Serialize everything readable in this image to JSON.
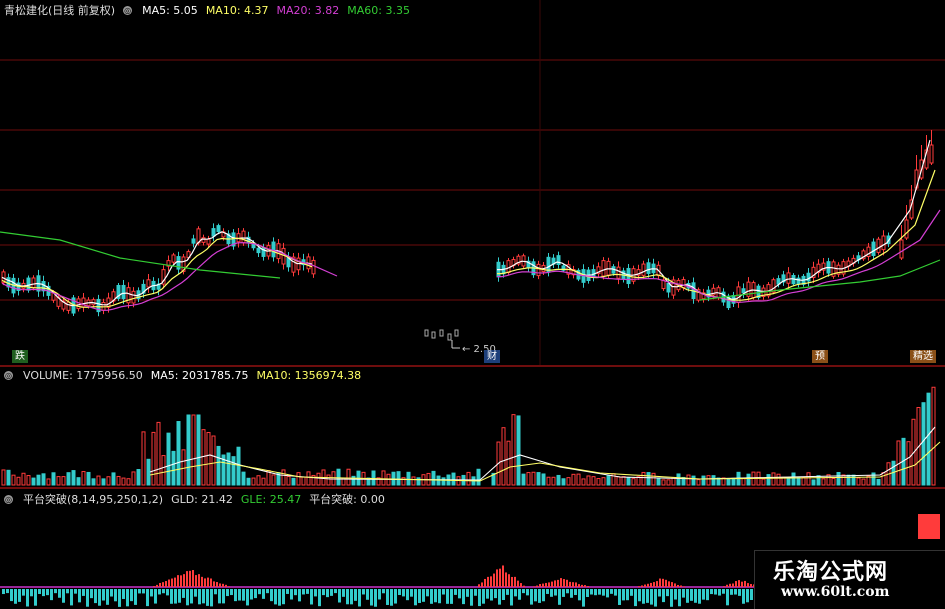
{
  "price": {
    "stock_label": "青松建化(日线 前复权)",
    "ma5": {
      "label": "MA5: 5.05",
      "color": "#ffffff"
    },
    "ma10": {
      "label": "MA10: 4.37",
      "color": "#ffff66"
    },
    "ma20": {
      "label": "MA20: 3.82",
      "color": "#d43fd4"
    },
    "ma60": {
      "label": "MA60: 3.35",
      "color": "#33cc33"
    },
    "low_annotation": "2.50",
    "markers": {
      "die": "跌",
      "cai": "财",
      "yu": "预",
      "jingxuan": "精选"
    }
  },
  "volume": {
    "label": "VOLUME: 1775956.50",
    "ma5": {
      "label": "MA5: 2031785.75",
      "color": "#ffffff"
    },
    "ma10": {
      "label": "MA10: 1356974.38",
      "color": "#ffff66"
    }
  },
  "indicator": {
    "label": "平台突破(8,14,95,250,1,2)",
    "gld": {
      "label": "GLD: 21.42",
      "color": "#dddddd"
    },
    "gle": {
      "label": "GLE: 25.47",
      "color": "#33cc33"
    },
    "breakout": {
      "label": "平台突破: 0.00",
      "color": "#dddddd"
    }
  },
  "watermark": {
    "title": "乐淘公式网",
    "url": "www.60lt.com"
  },
  "colors": {
    "up": "#ff3b3b",
    "down": "#33cccc",
    "grid": "#6e0d0d"
  }
}
